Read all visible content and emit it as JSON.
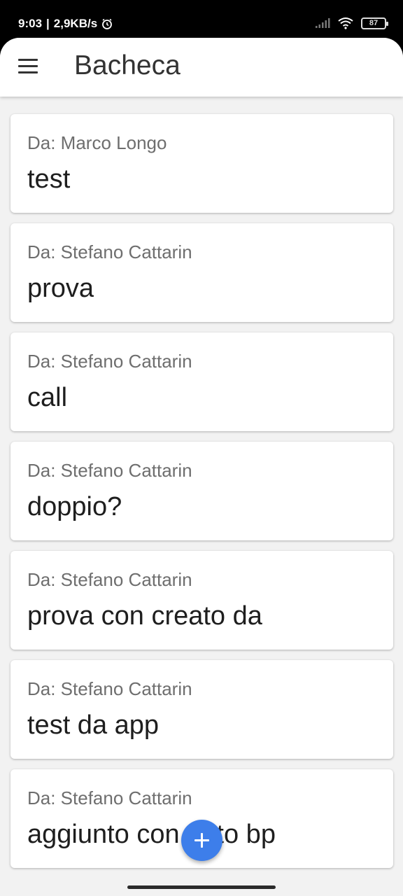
{
  "status_bar": {
    "time": "9:03",
    "network_speed": "2,9KB/s",
    "battery_level": "87"
  },
  "app_bar": {
    "title": "Bacheca"
  },
  "posts": [
    {
      "from": "Da: Marco Longo",
      "text": "test"
    },
    {
      "from": "Da: Stefano Cattarin",
      "text": "prova"
    },
    {
      "from": "Da: Stefano Cattarin",
      "text": "call"
    },
    {
      "from": "Da: Stefano Cattarin",
      "text": "doppio?"
    },
    {
      "from": "Da: Stefano Cattarin",
      "text": "prova con creato da"
    },
    {
      "from": "Da: Stefano Cattarin",
      "text": "test da app"
    },
    {
      "from": "Da: Stefano Cattarin",
      "text": "aggiunto con tutto bp"
    }
  ],
  "colors": {
    "fab": "#3d7eea",
    "background": "#f2f2f2",
    "card": "#ffffff"
  }
}
